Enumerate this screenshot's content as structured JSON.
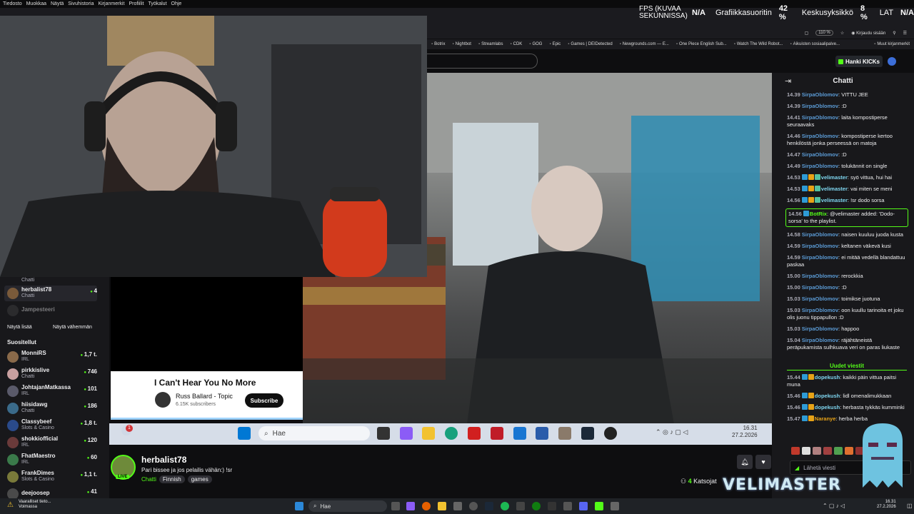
{
  "menubar": [
    "Tiedosto",
    "Muokkaa",
    "Näytä",
    "Sivuhistoria",
    "Kirjanmerkit",
    "Profiilit",
    "Työkalut",
    "Ohje"
  ],
  "overlay": {
    "fps_label": "FPS (KUVAA SEKUNNISSA)",
    "fps_value": "N/A",
    "gpu_label": "Grafiikkasuoritin",
    "gpu_value": "42 %",
    "ram_label": "Keskusyksikkö",
    "ram_value": "8 %",
    "lat_label": "LAT",
    "lat_value": "N/A"
  },
  "browser": {
    "zoom": "110 %",
    "login": "Kirjaudu sisään",
    "bookmarks": [
      "Botrix",
      "Nightbot",
      "Streamlabs",
      "CDK",
      "GOG",
      "Epic",
      "Games | DEIDetected",
      "Newgrounds.com — E...",
      "One Piece English Sub...",
      "Watch The Wild Robot...",
      "Aikuisten sosiaalipalve..."
    ],
    "other_bookmarks": "Muut kirjanmerkit"
  },
  "kick": {
    "get_kicks": "Hanki KICKs"
  },
  "sidebar": {
    "top_category": "Chatti",
    "following": [
      {
        "name": "herbalist78",
        "category": "Chatti",
        "viewers": "4",
        "avatar": "#7a5a3a"
      },
      {
        "name": "Jampesteeri",
        "category": "",
        "viewers": "",
        "avatar": "#444"
      }
    ],
    "show_more": "Näytä lisää",
    "show_less": "Näytä vähemmän",
    "recommended_title": "Suositellut",
    "recommended": [
      {
        "name": "MonniRS",
        "category": "IRL",
        "viewers": "1,7 t.",
        "avatar": "#8a6a4a"
      },
      {
        "name": "pirkkislive",
        "category": "Chatti",
        "viewers": "746",
        "avatar": "#c8a0a0"
      },
      {
        "name": "JohtajanMatkassa",
        "category": "IRL",
        "viewers": "101",
        "avatar": "#5a5a6a"
      },
      {
        "name": "hiisidawg",
        "category": "Chatti",
        "viewers": "186",
        "avatar": "#3a6a8a"
      },
      {
        "name": "Classybeef",
        "category": "Slots & Casino",
        "viewers": "1,8 t.",
        "avatar": "#2a4a8a"
      },
      {
        "name": "shokkiofficial",
        "category": "IRL",
        "viewers": "120",
        "avatar": "#6a3a3a"
      },
      {
        "name": "FhatMaestro",
        "category": "IRL",
        "viewers": "60",
        "avatar": "#3a7a4a"
      },
      {
        "name": "FrankDimes",
        "category": "Slots & Casino",
        "viewers": "1,1 t.",
        "avatar": "#7a7a3a"
      },
      {
        "name": "deejoosep",
        "category": "",
        "viewers": "41",
        "avatar": "#4a4a4a"
      }
    ]
  },
  "youtube": {
    "title": "I Can't Hear You No More",
    "channel": "Russ Ballard - Topic",
    "subscribers": "6.15K subscribers",
    "subscribe": "Subscribe"
  },
  "inner_taskbar": {
    "search": "Hae",
    "time": "16.31",
    "date": "27.2.2026",
    "notif": "1"
  },
  "channel": {
    "live": "LIVE",
    "name": "herbalist78",
    "title": "Pari bissee ja jos pelailis vähän:) !sr",
    "category": "Chatti",
    "tags": [
      "Finnish",
      "games"
    ],
    "viewers_count": "4",
    "viewers_label": "Katsojat"
  },
  "chat": {
    "title": "Chatti",
    "messages": [
      {
        "time": "14.39",
        "user": "SirpaOblomov",
        "color": "#5b9bd5",
        "text": "VITTU JEE",
        "badges": []
      },
      {
        "time": "14.39",
        "user": "SirpaOblomov",
        "color": "#5b9bd5",
        "text": ":D",
        "badges": []
      },
      {
        "time": "14.41",
        "user": "SirpaOblomov",
        "color": "#5b9bd5",
        "text": "laita kompostiperse seuraavaks",
        "badges": []
      },
      {
        "time": "14.46",
        "user": "SirpaOblomov",
        "color": "#5b9bd5",
        "text": "kompostiperse kertoo henkilöstä jonka perseessä on matoja",
        "badges": []
      },
      {
        "time": "14.47",
        "user": "SirpaOblomov",
        "color": "#5b9bd5",
        "text": ":D",
        "badges": []
      },
      {
        "time": "14.49",
        "user": "SirpaOblomov",
        "color": "#5b9bd5",
        "text": "tolukännit on single",
        "badges": []
      },
      {
        "time": "14.53",
        "user": "velimaster",
        "color": "#7fd6f0",
        "text": "syö vittua, hui hai",
        "badges": [
          "#2e9bd6",
          "#e8a317",
          "#53c0a0"
        ]
      },
      {
        "time": "14.53",
        "user": "velimaster",
        "color": "#7fd6f0",
        "text": "vai miten se meni",
        "badges": [
          "#2e9bd6",
          "#e8a317",
          "#53c0a0"
        ]
      },
      {
        "time": "14.56",
        "user": "velimaster",
        "color": "#7fd6f0",
        "text": "!sr dodo sorsa",
        "badges": [
          "#2e9bd6",
          "#e8a317",
          "#53c0a0"
        ]
      },
      {
        "time": "14.56",
        "user": "BotRix",
        "color": "#53fc18",
        "text": "@velimaster added: 'Dodo-sorsa' to the playlist.",
        "badges": [
          "#2e9bd6"
        ],
        "highlight": true
      },
      {
        "time": "14.58",
        "user": "SirpaOblomov",
        "color": "#5b9bd5",
        "text": "naisen kuuluu juoda kusta",
        "badges": []
      },
      {
        "time": "14.59",
        "user": "SirpaOblomov",
        "color": "#5b9bd5",
        "text": "keltanen väkevä kusi",
        "badges": []
      },
      {
        "time": "14.59",
        "user": "SirpaOblomov",
        "color": "#5b9bd5",
        "text": "ei mitää vedellä blandattuu paskaa",
        "badges": []
      },
      {
        "time": "15.00",
        "user": "SirpaOblomov",
        "color": "#5b9bd5",
        "text": "rerockkia",
        "badges": []
      },
      {
        "time": "15.00",
        "user": "SirpaOblomov",
        "color": "#5b9bd5",
        "text": ":D",
        "badges": []
      },
      {
        "time": "15.03",
        "user": "SirpaOblomov",
        "color": "#5b9bd5",
        "text": "toimikse juotuna",
        "badges": []
      },
      {
        "time": "15.03",
        "user": "SirpaOblomov",
        "color": "#5b9bd5",
        "text": "oon kuullu tarinoita et joku olis juonu tippapullon :D",
        "badges": []
      },
      {
        "time": "15.03",
        "user": "SirpaOblomov",
        "color": "#5b9bd5",
        "text": "happoo",
        "badges": []
      },
      {
        "time": "15.04",
        "user": "SirpaOblomov",
        "color": "#5b9bd5",
        "text": "räjähtäneistä peräpukamista sulhkuava veri on paras liukaste",
        "badges": []
      }
    ],
    "new_messages_label": "Uudet viestit",
    "new_messages": [
      {
        "time": "15.44",
        "user": "dopekush",
        "color": "#7fd6f0",
        "text": "kaikki päin vittua paitsi muna",
        "badges": [
          "#2e9bd6",
          "#e8a317"
        ]
      },
      {
        "time": "15.46",
        "user": "dopekush",
        "color": "#7fd6f0",
        "text": "lidl omenalimukkaan",
        "badges": [
          "#2e9bd6",
          "#e8a317"
        ]
      },
      {
        "time": "15.46",
        "user": "dopekush",
        "color": "#7fd6f0",
        "text": "herbasta tykkäs kumminki",
        "badges": [
          "#2e9bd6",
          "#e8a317"
        ]
      },
      {
        "time": "15.47",
        "user": "Naranye",
        "color": "#e8a317",
        "text": "herba herba",
        "badges": [
          "#2e9bd6",
          "#e8a317"
        ]
      }
    ],
    "send_placeholder": "Lähetä viesti",
    "logo": "VELIMASTER"
  },
  "taskbar": {
    "warning_line1": "Vaaralliset tieto...",
    "warning_line2": "Voimassa",
    "search": "Hae",
    "time": "16.31",
    "date": "27.2.2026"
  }
}
